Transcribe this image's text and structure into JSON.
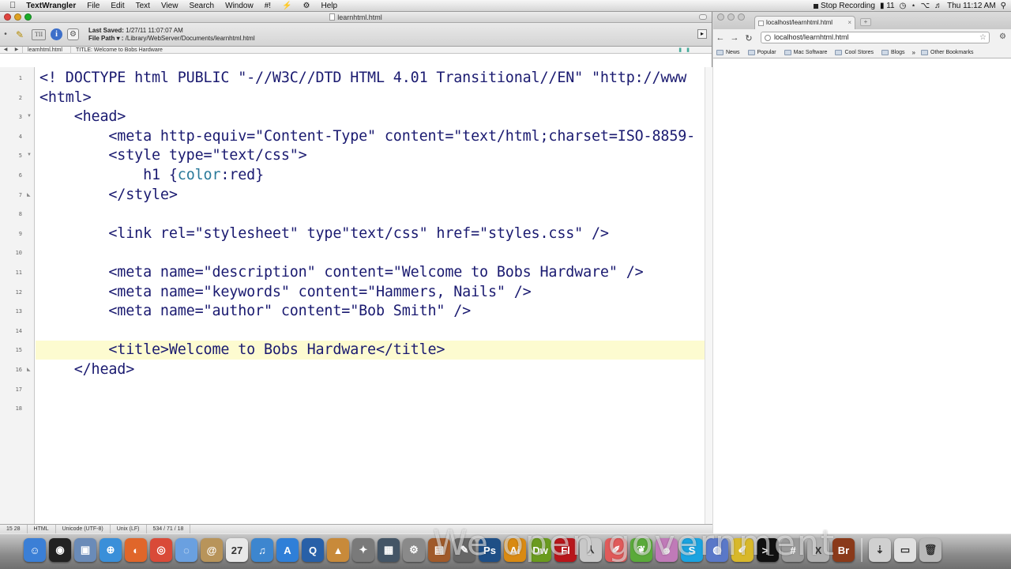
{
  "menubar": {
    "items": [
      "TextWrangler",
      "File",
      "Edit",
      "Text",
      "View",
      "Search",
      "Window",
      "#!",
      "⚡",
      "⚙",
      "Help"
    ],
    "recording": "Stop Recording",
    "battery_level": "11",
    "clock": "Thu 11:12 AM"
  },
  "editor_window": {
    "title": "learnhtml.html",
    "last_saved_label": "Last Saved:",
    "last_saved_value": "1/27/11 11:07:07 AM",
    "file_path_label": "File Path ▾ :",
    "file_path_value": "/Library/WebServer/Documents/learnhtml.html",
    "nav_file": "learnhtml.html",
    "nav_title": "TITLE: Welcome to Bobs Hardware",
    "line_numbers": [
      "1",
      "2",
      "3",
      "4",
      "5",
      "6",
      "7",
      "8",
      "9",
      "10",
      "11",
      "12",
      "13",
      "14",
      "15",
      "16",
      "17",
      "18"
    ],
    "lines": [
      "<! DOCTYPE html PUBLIC \"-//W3C//DTD HTML 4.01 Transitional//EN\" \"http://www",
      "<html>",
      "    <head>",
      "        <meta http-equiv=\"Content-Type\" content=\"text/html;charset=ISO-8859-",
      "        <style type=\"text/css\">",
      "            h1 {color:red}",
      "        </style>",
      "",
      "        <link rel=\"stylesheet\" type\"text/css\" href=\"styles.css\" />",
      "",
      "        <meta name=\"description\" content=\"Welcome to Bobs Hardware\" />",
      "        <meta name=\"keywords\" content=\"Hammers, Nails\" />",
      "        <meta name=\"author\" content=\"Bob Smith\" />",
      "",
      "        <title>Welcome to Bobs Hardware</title>",
      "    </head>",
      "",
      ""
    ],
    "current_line_index": 14,
    "status": {
      "position": "15 28",
      "language": "HTML",
      "encoding": "Unicode (UTF-8)",
      "line_endings": "Unix (LF)",
      "counts": "534 / 71 / 18"
    }
  },
  "browser": {
    "tab_title": "localhost/learnhtml.html",
    "url": "localhost/learnhtml.html",
    "bookmarks": [
      "News",
      "Popular",
      "Mac Software",
      "Cool Stores",
      "Blogs"
    ],
    "bookmarks_more": "»",
    "other_bookmarks": "Other Bookmarks"
  },
  "dock": {
    "apps": [
      {
        "name": "finder",
        "color": "#3b7fd6",
        "glyph": "☺"
      },
      {
        "name": "dashboard",
        "color": "#222222",
        "glyph": "◉"
      },
      {
        "name": "preview",
        "color": "#6a8bb8",
        "glyph": "▣"
      },
      {
        "name": "safari",
        "color": "#3a8fd9",
        "glyph": "⊕"
      },
      {
        "name": "firefox",
        "color": "#e0662a",
        "glyph": "◐"
      },
      {
        "name": "chrome",
        "color": "#d94a38",
        "glyph": "◎"
      },
      {
        "name": "ichat",
        "color": "#6aa0e0",
        "glyph": "◌"
      },
      {
        "name": "address-book",
        "color": "#b8945a",
        "glyph": "@"
      },
      {
        "name": "ical",
        "color": "#e8e8e8",
        "glyph": "27"
      },
      {
        "name": "itunes",
        "color": "#3d86cf",
        "glyph": "♫"
      },
      {
        "name": "app-store",
        "color": "#2f7fd8",
        "glyph": "A"
      },
      {
        "name": "quicktime",
        "color": "#2860a8",
        "glyph": "Q"
      },
      {
        "name": "photo-app",
        "color": "#c88a3a",
        "glyph": "▲"
      },
      {
        "name": "xcode",
        "color": "#7a7a7a",
        "glyph": "✦"
      },
      {
        "name": "expose",
        "color": "#445566",
        "glyph": "▦"
      },
      {
        "name": "system-preferences",
        "color": "#8a8a8a",
        "glyph": "⚙"
      },
      {
        "name": "photo-booth",
        "color": "#a05a2a",
        "glyph": "▤"
      },
      {
        "name": "script-editor",
        "color": "#666666",
        "glyph": "✎"
      },
      {
        "name": "photoshop",
        "color": "#1f4f86",
        "glyph": "Ps"
      },
      {
        "name": "illustrator",
        "color": "#d98a12",
        "glyph": "Ai"
      },
      {
        "name": "dreamweaver",
        "color": "#6a9b1e",
        "glyph": "Dw"
      },
      {
        "name": "flash",
        "color": "#b8161b",
        "glyph": "Fl"
      },
      {
        "name": "acrobat",
        "color": "#c8c8c8",
        "glyph": "⅄"
      },
      {
        "name": "textedit",
        "color": "#e05a5a",
        "glyph": "✐"
      },
      {
        "name": "evernote",
        "color": "#5aaa3a",
        "glyph": "❦"
      },
      {
        "name": "utility",
        "color": "#c07ab8",
        "glyph": "☻"
      },
      {
        "name": "skype",
        "color": "#1aa3e0",
        "glyph": "S"
      },
      {
        "name": "network",
        "color": "#5a78c8",
        "glyph": "◍"
      },
      {
        "name": "textwrangler",
        "color": "#d8b82a",
        "glyph": "✐"
      },
      {
        "name": "terminal",
        "color": "#111111",
        "glyph": ">_"
      },
      {
        "name": "calculator",
        "color": "#9a9a9a",
        "glyph": "#"
      },
      {
        "name": "x11",
        "color": "#b0b0b0",
        "glyph": "X"
      },
      {
        "name": "bridge",
        "color": "#8a3a1a",
        "glyph": "Br"
      },
      {
        "name": "downloads",
        "color": "#d0d0d0",
        "glyph": "⇣"
      },
      {
        "name": "documents",
        "color": "#e0e0e0",
        "glyph": "▭"
      },
      {
        "name": "trash",
        "color": "#b8b8b8",
        "glyph": "🗑"
      }
    ],
    "overlay_text": "We open government"
  }
}
